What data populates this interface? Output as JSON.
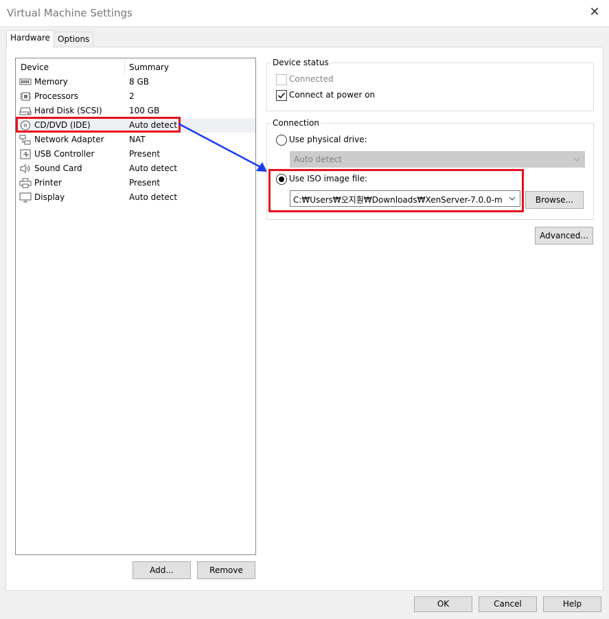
{
  "window": {
    "title": "Virtual Machine Settings",
    "close_glyph": "✕"
  },
  "tabs": [
    {
      "label": "Hardware",
      "active": true
    },
    {
      "label": "Options",
      "active": false
    }
  ],
  "device_list": {
    "headers": {
      "device": "Device",
      "summary": "Summary"
    },
    "items": [
      {
        "device": "Memory",
        "summary": "8 GB",
        "icon": "memory-icon"
      },
      {
        "device": "Processors",
        "summary": "2",
        "icon": "processor-icon"
      },
      {
        "device": "Hard Disk (SCSI)",
        "summary": "100 GB",
        "icon": "hard-disk-icon"
      },
      {
        "device": "CD/DVD (IDE)",
        "summary": "Auto detect",
        "icon": "cd-dvd-icon",
        "selected": true
      },
      {
        "device": "Network Adapter",
        "summary": "NAT",
        "icon": "network-adapter-icon"
      },
      {
        "device": "USB Controller",
        "summary": "Present",
        "icon": "usb-icon"
      },
      {
        "device": "Sound Card",
        "summary": "Auto detect",
        "icon": "sound-icon"
      },
      {
        "device": "Printer",
        "summary": "Present",
        "icon": "printer-icon"
      },
      {
        "device": "Display",
        "summary": "Auto detect",
        "icon": "display-icon"
      }
    ]
  },
  "list_buttons": {
    "add": "Add...",
    "remove": "Remove"
  },
  "device_status": {
    "label": "Device status",
    "connected": {
      "label": "Connected",
      "checked": false,
      "disabled": true
    },
    "connect_at_power_on": {
      "label": "Connect at power on",
      "checked": true
    }
  },
  "connection": {
    "label": "Connection",
    "physical_drive": {
      "label": "Use physical drive:",
      "selected": false,
      "value": "Auto detect"
    },
    "iso_image": {
      "label": "Use ISO image file:",
      "selected": true,
      "value": "C:₩Users₩오지훤₩Downloads₩XenServer-7.0.0-m"
    },
    "browse_label": "Browse..."
  },
  "advanced_label": "Advanced...",
  "footer": {
    "ok": "OK",
    "cancel": "Cancel",
    "help": "Help"
  },
  "annotation_colors": {
    "highlight": "#e8101c",
    "arrow": "#1a3cf0"
  }
}
